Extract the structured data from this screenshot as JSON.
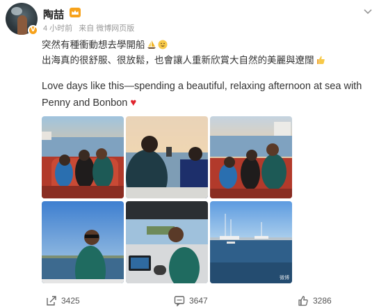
{
  "post": {
    "author": "陶喆",
    "verified_badge": "V",
    "time": "4 小时前",
    "source": "来自 微博网页版"
  },
  "content": {
    "line1": "突然有種衝動想去學開船",
    "line2": "出海真的很舒服、很放鬆，也會讓人重新欣賞大自然的美麗與遼闊",
    "line3": "Love days like this—spending a beautiful, relaxing afternoon at sea with",
    "line4": "Penny and Bonbon",
    "heart": "♥"
  },
  "photos": [
    {
      "id": "photo-1",
      "scene": "family on boat seat"
    },
    {
      "id": "photo-2",
      "scene": "man at helm facing sea"
    },
    {
      "id": "photo-3",
      "scene": "family on boat seat smiling"
    },
    {
      "id": "photo-4",
      "scene": "man in sunglasses at sea"
    },
    {
      "id": "photo-5",
      "scene": "man driving boat"
    },
    {
      "id": "photo-6",
      "scene": "harbor with sailboats"
    }
  ],
  "photo_watermark": "微博",
  "actions": {
    "share": "3425",
    "comment": "3647",
    "like": "3286"
  },
  "colors": {
    "badge": "#f7a21b",
    "heart": "#e0242d",
    "meta": "#999999"
  }
}
